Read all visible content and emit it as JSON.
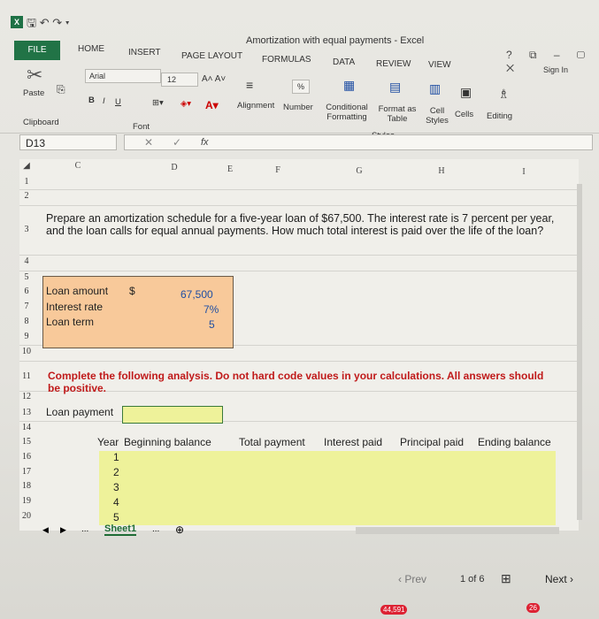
{
  "window": {
    "title": "Amortization with equal payments - Excel",
    "qat_icons": [
      "save-icon",
      "undo-icon",
      "redo-icon",
      "customize-icon"
    ],
    "window_controls": "?  ⧉  –  ▢  ✕",
    "sign_in": "Sign In"
  },
  "tabs": [
    "FILE",
    "HOME",
    "INSERT",
    "PAGE LAYOUT",
    "FORMULAS",
    "DATA",
    "REVIEW",
    "VIEW"
  ],
  "ribbon": {
    "paste": "Paste",
    "clipboard": "Clipboard",
    "font_name": "Arial",
    "font_size": "12",
    "font_group": "Font",
    "bold": "B",
    "italic": "I",
    "underline": "U",
    "alignment": "Alignment",
    "number": "Number",
    "percent": "%",
    "conditional_formatting": "Conditional Formatting",
    "format_as_table": "Format as Table",
    "cell_styles": "Cell Styles",
    "styles": "Styles",
    "cells": "Cells",
    "editing": "Editing"
  },
  "formula_bar": {
    "name_box": "D13",
    "fx": "fx",
    "value": ""
  },
  "columns": [
    "C",
    "D",
    "E",
    "F",
    "G",
    "H",
    "I"
  ],
  "rows": [
    "1",
    "2",
    "3",
    "4",
    "5",
    "6",
    "7",
    "8",
    "9",
    "10",
    "11",
    "12",
    "13",
    "14",
    "15",
    "16",
    "17",
    "18",
    "19",
    "20"
  ],
  "sheet": {
    "prompt": "Prepare an amortization schedule for a five-year loan of $67,500. The interest rate is 7 percent per year, and the loan calls for equal annual payments. How much total interest is paid over the life of the loan?",
    "inputs": [
      {
        "label": "Loan amount",
        "prefix": "$",
        "value": "67,500"
      },
      {
        "label": "Interest rate",
        "prefix": "",
        "value": "7%"
      },
      {
        "label": "Loan term",
        "prefix": "",
        "value": "5"
      }
    ],
    "instruction": "Complete the following analysis. Do not hard code values in your calculations. All answers should be positive.",
    "loan_payment_label": "Loan payment",
    "table_headers": [
      "Year",
      "Beginning balance",
      "Total payment",
      "Interest paid",
      "Principal paid",
      "Ending balance"
    ],
    "years": [
      "1",
      "2",
      "3",
      "4",
      "5"
    ],
    "sheet_tab": "Sheet1"
  },
  "nav": {
    "prev": "Prev",
    "page": "1 of 6",
    "next": "Next"
  },
  "taskbar": {
    "badge_count": "44,591",
    "badge_count_2": "26"
  },
  "colors": {
    "excel_green": "#217346",
    "input_fill": "#f8c99a",
    "answer_fill": "#eef29a",
    "instruction_red": "#c01a1a",
    "value_blue": "#1f4ea3"
  }
}
